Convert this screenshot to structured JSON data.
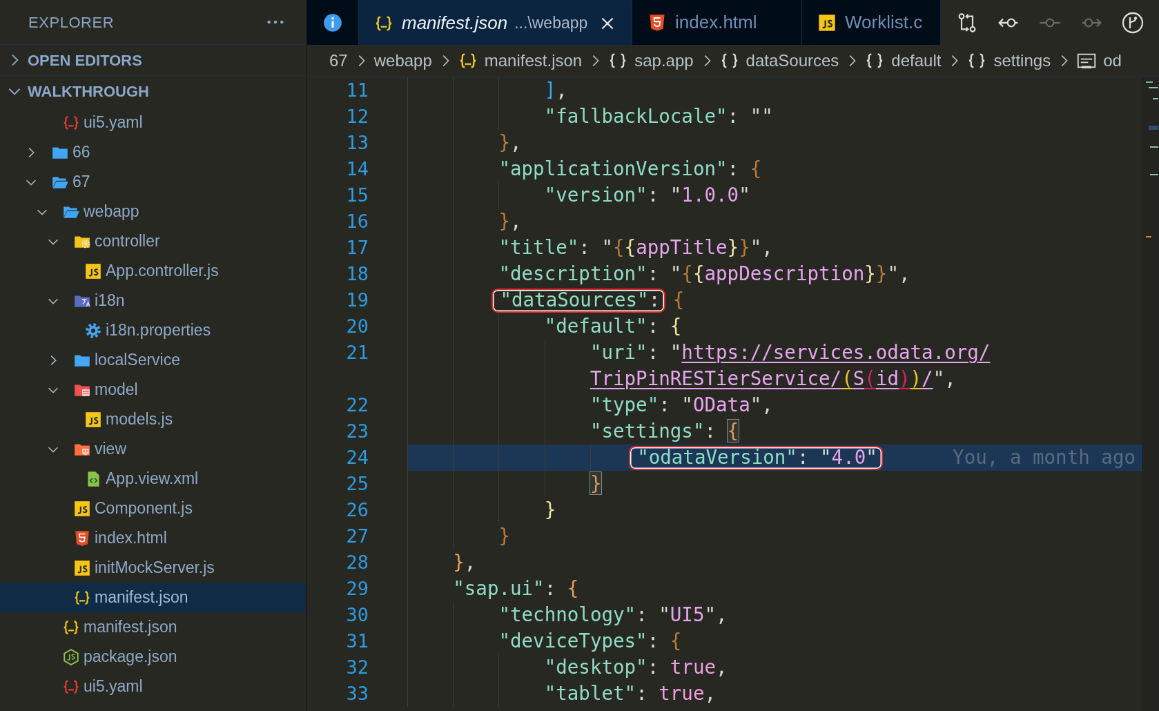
{
  "sidebar": {
    "title": "EXPLORER",
    "sections": [
      {
        "label": "OPEN EDITORS",
        "expanded": false
      },
      {
        "label": "WALKTHROUGH",
        "expanded": true,
        "tree": [
          {
            "children": [
              {
                "label": "ui5.yaml",
                "kind": "yaml",
                "selected": false
              }
            ]
          },
          {
            "label": "66",
            "kind": "folder",
            "expanded": false,
            "selected": false
          },
          {
            "label": "67",
            "kind": "folder",
            "expanded": true,
            "selected": false,
            "children": [
              {
                "label": "webapp",
                "kind": "folder",
                "expanded": true,
                "selected": false,
                "children": [
                  {
                    "label": "controller",
                    "kind": "folder-controller",
                    "expanded": true,
                    "selected": false,
                    "children": [
                      {
                        "label": "App.controller.js",
                        "kind": "js",
                        "selected": false
                      }
                    ]
                  },
                  {
                    "label": "i18n",
                    "kind": "folder-i18n",
                    "expanded": true,
                    "selected": false,
                    "children": [
                      {
                        "label": "i18n.properties",
                        "kind": "gear",
                        "selected": false
                      }
                    ]
                  },
                  {
                    "label": "localService",
                    "kind": "folder",
                    "expanded": false,
                    "selected": false
                  },
                  {
                    "label": "model",
                    "kind": "folder-model",
                    "expanded": true,
                    "selected": false,
                    "children": [
                      {
                        "label": "models.js",
                        "kind": "js",
                        "selected": false
                      }
                    ]
                  },
                  {
                    "label": "view",
                    "kind": "folder-view",
                    "expanded": true,
                    "selected": false,
                    "children": [
                      {
                        "label": "App.view.xml",
                        "kind": "xml",
                        "selected": false
                      }
                    ]
                  },
                  {
                    "label": "Component.js",
                    "kind": "js",
                    "selected": false
                  },
                  {
                    "label": "index.html",
                    "kind": "html",
                    "selected": false
                  },
                  {
                    "label": "initMockServer.js",
                    "kind": "js",
                    "selected": false
                  },
                  {
                    "label": "manifest.json",
                    "kind": "json",
                    "selected": true
                  }
                ]
              },
              {
                "label": "manifest.json",
                "kind": "json",
                "selected": false
              },
              {
                "label": "package.json",
                "kind": "node",
                "selected": false
              },
              {
                "label": "ui5.yaml",
                "kind": "yaml",
                "selected": false
              }
            ]
          }
        ]
      }
    ]
  },
  "tabs": [
    {
      "kind": "info",
      "selected": false
    },
    {
      "kind": "json",
      "label": "manifest.json",
      "description": "...\\webapp",
      "preview": true,
      "selected": true
    },
    {
      "kind": "html",
      "label": "index.html",
      "preview": false,
      "selected": false
    },
    {
      "kind": "js",
      "label": "Worklist.c",
      "preview": false,
      "selected": false
    }
  ],
  "editor_actions": [
    {
      "kind": "compare",
      "disabled": false
    },
    {
      "kind": "back",
      "disabled": false
    },
    {
      "kind": "commit",
      "disabled": true
    },
    {
      "kind": "forward",
      "disabled": true
    },
    {
      "kind": "branch",
      "disabled": false
    }
  ],
  "breadcrumbs": [
    {
      "label": "67"
    },
    {
      "label": "webapp"
    },
    {
      "kind": "json",
      "label": "manifest.json"
    },
    {
      "kind": "object",
      "label": "sap.app"
    },
    {
      "kind": "object",
      "label": "dataSources"
    },
    {
      "kind": "object",
      "label": "default"
    },
    {
      "kind": "object",
      "label": "settings"
    },
    {
      "kind": "string",
      "label": "od"
    }
  ],
  "editor": {
    "lines": [
      {
        "children": [
          {
            "children": [
              {
                "number": "11",
                "current": false,
                "groups": [
                  {
                    "outlined": false,
                    "tokens": [
                      {
                        "kind": "bracket4",
                        "text": "]"
                      },
                      {
                        "kind": "punct",
                        "text": ","
                      }
                    ]
                  }
                ]
              },
              {
                "number": "12",
                "current": false,
                "groups": [
                  {
                    "outlined": false,
                    "tokens": [
                      {
                        "kind": "key",
                        "text": "\"fallbackLocale\""
                      },
                      {
                        "kind": "punct",
                        "text": ": \"\""
                      }
                    ]
                  }
                ]
              }
            ]
          },
          {
            "number": "13",
            "current": false,
            "groups": [
              {
                "outlined": false,
                "tokens": [
                  {
                    "kind": "bracket2",
                    "text": "}"
                  },
                  {
                    "kind": "punct",
                    "text": ","
                  }
                ]
              }
            ]
          },
          {
            "number": "14",
            "current": false,
            "groups": [
              {
                "outlined": false,
                "tokens": [
                  {
                    "kind": "key",
                    "text": "\"applicationVersion\""
                  },
                  {
                    "kind": "punct",
                    "text": ": "
                  },
                  {
                    "kind": "bracket2",
                    "text": "{"
                  }
                ]
              }
            ],
            "children": [
              {
                "number": "15",
                "current": false,
                "groups": [
                  {
                    "outlined": false,
                    "tokens": [
                      {
                        "kind": "key",
                        "text": "\"version\""
                      },
                      {
                        "kind": "punct",
                        "text": ": \""
                      },
                      {
                        "kind": "string",
                        "text": "1.0.0"
                      },
                      {
                        "kind": "punct",
                        "text": "\""
                      }
                    ]
                  }
                ]
              }
            ]
          },
          {
            "number": "16",
            "current": false,
            "groups": [
              {
                "outlined": false,
                "tokens": [
                  {
                    "kind": "bracket2",
                    "text": "}"
                  },
                  {
                    "kind": "punct",
                    "text": ","
                  }
                ]
              }
            ]
          },
          {
            "number": "17",
            "current": false,
            "groups": [
              {
                "outlined": false,
                "tokens": [
                  {
                    "kind": "key",
                    "text": "\"title\""
                  },
                  {
                    "kind": "punct",
                    "text": ": \""
                  },
                  {
                    "kind": "bracket2",
                    "text": "{"
                  },
                  {
                    "kind": "bracket3",
                    "text": "{"
                  },
                  {
                    "kind": "string",
                    "text": "appTitle"
                  },
                  {
                    "kind": "bracket3",
                    "text": "}"
                  },
                  {
                    "kind": "bracket2",
                    "text": "}"
                  },
                  {
                    "kind": "punct",
                    "text": "\","
                  }
                ]
              }
            ]
          },
          {
            "number": "18",
            "current": false,
            "groups": [
              {
                "outlined": false,
                "tokens": [
                  {
                    "kind": "key",
                    "text": "\"description\""
                  },
                  {
                    "kind": "punct",
                    "text": ": \""
                  },
                  {
                    "kind": "bracket2",
                    "text": "{"
                  },
                  {
                    "kind": "bracket3",
                    "text": "{"
                  },
                  {
                    "kind": "string",
                    "text": "appDescription"
                  },
                  {
                    "kind": "bracket3",
                    "text": "}"
                  },
                  {
                    "kind": "bracket2",
                    "text": "}"
                  },
                  {
                    "kind": "punct",
                    "text": "\","
                  }
                ]
              }
            ]
          },
          {
            "number": "19",
            "current": false,
            "groups": [
              {
                "outlined": true,
                "tokens": [
                  {
                    "kind": "key",
                    "text": "\"dataSources\""
                  },
                  {
                    "kind": "punct",
                    "text": ":"
                  }
                ]
              },
              {
                "outlined": false,
                "tokens": [
                  {
                    "kind": "bracket2",
                    "text": "{"
                  }
                ]
              }
            ],
            "children": [
              {
                "number": "20",
                "current": false,
                "groups": [
                  {
                    "outlined": false,
                    "tokens": [
                      {
                        "kind": "key",
                        "text": "\"default\""
                      },
                      {
                        "kind": "punct",
                        "text": ": "
                      },
                      {
                        "kind": "bracket3",
                        "text": "{"
                      }
                    ]
                  }
                ],
                "children": [
                  {
                    "number": "21",
                    "current": false,
                    "groups": [
                      {
                        "outlined": false,
                        "tokens": [
                          {
                            "kind": "key",
                            "text": "\"uri\""
                          },
                          {
                            "kind": "punct",
                            "text": ": \""
                          },
                          {
                            "kind": "link",
                            "text": "https://services.odata.org/"
                          }
                        ]
                      }
                    ]
                  },
                  {
                    "current": false,
                    "groups": [
                      {
                        "outlined": false,
                        "tokens": [
                          {
                            "kind": "link",
                            "text": "TripPinRESTierService/"
                          },
                          {
                            "kind": "linkparen1",
                            "text": "("
                          },
                          {
                            "kind": "link",
                            "text": "S"
                          },
                          {
                            "kind": "linkparen2",
                            "text": "("
                          },
                          {
                            "kind": "link",
                            "text": "id"
                          },
                          {
                            "kind": "linkparen2",
                            "text": ")"
                          },
                          {
                            "kind": "linkparen1",
                            "text": ")"
                          },
                          {
                            "kind": "link",
                            "text": "/"
                          },
                          {
                            "kind": "punct",
                            "text": "\","
                          }
                        ]
                      }
                    ]
                  },
                  {
                    "number": "22",
                    "current": false,
                    "groups": [
                      {
                        "outlined": false,
                        "tokens": [
                          {
                            "kind": "key",
                            "text": "\"type\""
                          },
                          {
                            "kind": "punct",
                            "text": ": \""
                          },
                          {
                            "kind": "string",
                            "text": "OData"
                          },
                          {
                            "kind": "punct",
                            "text": "\","
                          }
                        ]
                      }
                    ]
                  },
                  {
                    "number": "23",
                    "current": false,
                    "groups": [
                      {
                        "outlined": false,
                        "tokens": [
                          {
                            "kind": "key",
                            "text": "\"settings\""
                          },
                          {
                            "kind": "punct",
                            "text": ": "
                          },
                          {
                            "kind": "matched",
                            "text": "{"
                          }
                        ]
                      }
                    ],
                    "children": [
                      {
                        "number": "24",
                        "current": true,
                        "blame": "You, a month ago",
                        "groups": [
                          {
                            "outlined": true,
                            "tokens": [
                              {
                                "kind": "key",
                                "text": "\"odataVersion\""
                              },
                              {
                                "kind": "punct",
                                "text": ": \""
                              },
                              {
                                "kind": "string",
                                "text": "4.0"
                              },
                              {
                                "kind": "punct",
                                "text": "\""
                              }
                            ]
                          }
                        ]
                      }
                    ]
                  },
                  {
                    "number": "25",
                    "current": false,
                    "groups": [
                      {
                        "outlined": false,
                        "tokens": [
                          {
                            "kind": "matched",
                            "text": "}"
                          }
                        ]
                      }
                    ]
                  }
                ]
              },
              {
                "number": "26",
                "current": false,
                "groups": [
                  {
                    "outlined": false,
                    "tokens": [
                      {
                        "kind": "bracket3",
                        "text": "}"
                      }
                    ]
                  }
                ]
              }
            ]
          },
          {
            "number": "27",
            "current": false,
            "groups": [
              {
                "outlined": false,
                "tokens": [
                  {
                    "kind": "bracket2",
                    "text": "}"
                  }
                ]
              }
            ]
          }
        ]
      },
      {
        "number": "28",
        "current": false,
        "groups": [
          {
            "outlined": false,
            "tokens": [
              {
                "kind": "bracket1",
                "text": "}"
              },
              {
                "kind": "punct",
                "text": ","
              }
            ]
          }
        ]
      },
      {
        "number": "29",
        "current": false,
        "groups": [
          {
            "outlined": false,
            "tokens": [
              {
                "kind": "key",
                "text": "\"sap.ui\""
              },
              {
                "kind": "punct",
                "text": ": "
              },
              {
                "kind": "bracket1",
                "text": "{"
              }
            ]
          }
        ],
        "children": [
          {
            "number": "30",
            "current": false,
            "groups": [
              {
                "outlined": false,
                "tokens": [
                  {
                    "kind": "key",
                    "text": "\"technology\""
                  },
                  {
                    "kind": "punct",
                    "text": ": \""
                  },
                  {
                    "kind": "string",
                    "text": "UI5"
                  },
                  {
                    "kind": "punct",
                    "text": "\","
                  }
                ]
              }
            ]
          },
          {
            "number": "31",
            "current": false,
            "groups": [
              {
                "outlined": false,
                "tokens": [
                  {
                    "kind": "key",
                    "text": "\"deviceTypes\""
                  },
                  {
                    "kind": "punct",
                    "text": ": "
                  },
                  {
                    "kind": "bracket2",
                    "text": "{"
                  }
                ]
              }
            ],
            "children": [
              {
                "number": "32",
                "current": false,
                "groups": [
                  {
                    "outlined": false,
                    "tokens": [
                      {
                        "kind": "key",
                        "text": "\"desktop\""
                      },
                      {
                        "kind": "punct",
                        "text": ": "
                      },
                      {
                        "kind": "literal",
                        "text": "true"
                      },
                      {
                        "kind": "punct",
                        "text": ","
                      }
                    ]
                  }
                ]
              },
              {
                "number": "33",
                "current": false,
                "groups": [
                  {
                    "outlined": false,
                    "tokens": [
                      {
                        "kind": "key",
                        "text": "\"tablet\""
                      },
                      {
                        "kind": "punct",
                        "text": ": "
                      },
                      {
                        "kind": "literal",
                        "text": "true"
                      },
                      {
                        "kind": "punct",
                        "text": ","
                      }
                    ]
                  }
                ]
              }
            ]
          }
        ]
      }
    ]
  }
}
